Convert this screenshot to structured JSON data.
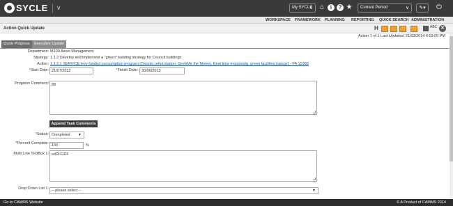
{
  "app": {
    "brand": "SYCLE"
  },
  "topbar": {
    "scope_select": "My SYCLE",
    "period_select": "Current Period",
    "icons": [
      "home-icon",
      "info-icon",
      "help-icon",
      "star-icon",
      "wrench-icon",
      "power-icon"
    ],
    "info_glyph": "i",
    "help_glyph": "?"
  },
  "menu": {
    "items": [
      "WORKSPACE",
      "FRAMEWORK",
      "PLANNING",
      "REPORTING",
      "QUICK SEARCH",
      "ADMINISTRATION"
    ]
  },
  "page": {
    "title": "Action Quick Update",
    "toolbar_h": "H",
    "spell_label": "ABC",
    "close_glyph": "✕",
    "updated": "Action 1 of 1  Last Updated: 21/03/2014 4:03:05 PM"
  },
  "tabs": [
    "Quick Progress",
    "Executive Update"
  ],
  "form": {
    "department_label": "Department:",
    "department_value": "M100 Asset Management",
    "strategy_label": "Strategy:",
    "strategy_value": "1.1.2 Develop and implement a \"green\" building strategy for Council buildings",
    "action_label": "Action:",
    "action_value": "1.1.2.1 SERVICE levy funded consumption program (Toronto refuit station, GrowMe the Money, Real time monitoorig, green facilities trategy) - PA 15380",
    "required_mark": "*",
    "start_date_label": "Start Date:",
    "start_date_value": "21/07/2012",
    "finish_date_label": "Finish Date:",
    "finish_date_value": "30/06/2013",
    "progress_comment_label": "Progress Comment:",
    "progress_comment_value": "88",
    "append_button": "Append Task Comments",
    "status_label": "Status:",
    "status_value": "Completed",
    "percent_label": "Percent Complete:",
    "percent_value": "100",
    "percent_unit": "%",
    "multiline_label": "Multi Line TextBox 1:",
    "multiline_value": "sdDFGDF",
    "dropdown_label": "Drop Down List 1:",
    "dropdown_value": "-- please select --"
  },
  "footer": {
    "left": "Go to CAMMS Website",
    "right": "© A Product of CAMMS 2014"
  },
  "colors": {
    "topbar": "#3a3a3a",
    "accent": "#f0a030",
    "link": "#2255aa",
    "required": "#cc2222",
    "footer": "#2d2d2d"
  }
}
